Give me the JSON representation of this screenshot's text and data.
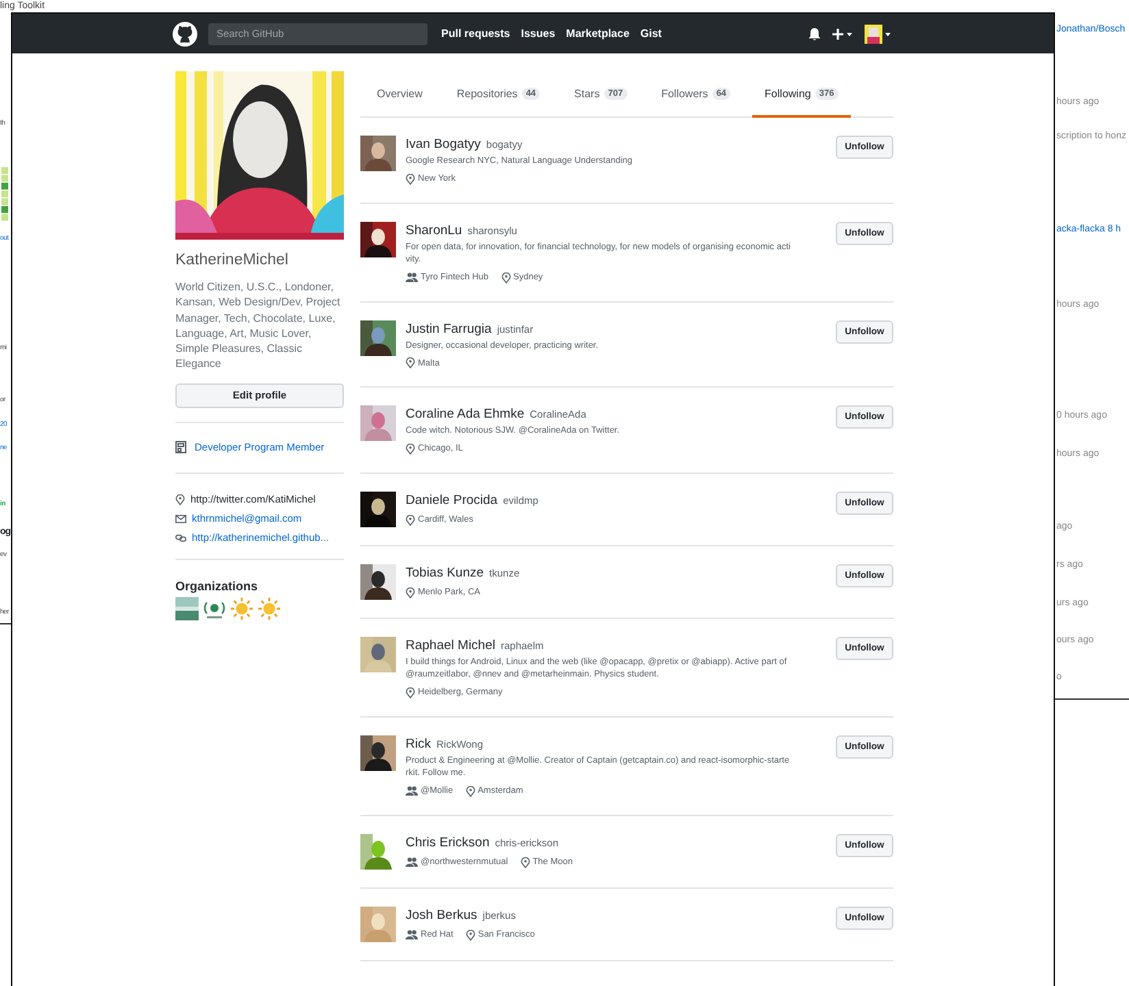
{
  "background": {
    "left_fragments": [
      "ling Toolkit",
      "th",
      "out",
      "mi",
      "or",
      "20",
      "ne",
      "in",
      "og",
      "ev",
      "her"
    ],
    "right_fragments": [
      "Jonathan/Bosch",
      "hours ago",
      "scription to honz",
      "acka-flacka 8 h",
      "hours ago",
      "0 hours ago",
      "hours ago",
      "ago",
      "rs ago",
      "urs ago",
      "ours ago",
      "o"
    ]
  },
  "header": {
    "search": {
      "placeholder": "Search GitHub"
    },
    "nav": [
      "Pull requests",
      "Issues",
      "Marketplace",
      "Gist"
    ]
  },
  "profile": {
    "username": "KatherineMichel",
    "bio": "World Citizen, U.S.C., Londoner, Kansan, Web Design/Dev, Project Manager, Tech, Chocolate, Luxe, Language, Art, Music Lover, Simple Pleasures, Classic Elegance",
    "edit_button": "Edit profile",
    "badge": "Developer Program Member",
    "links": [
      {
        "kind": "location",
        "text": "http://twitter.com/KatiMichel"
      },
      {
        "kind": "email",
        "text": "kthrnmichel@gmail.com"
      },
      {
        "kind": "website",
        "text": "http://katherinemichel.github..."
      }
    ],
    "organizations_title": "Organizations"
  },
  "tabs": [
    {
      "label": "Overview",
      "selected": false
    },
    {
      "label": "Repositories",
      "count": "44",
      "selected": false
    },
    {
      "label": "Stars",
      "count": "707",
      "selected": false
    },
    {
      "label": "Followers",
      "count": "64",
      "selected": false
    },
    {
      "label": "Following",
      "count": "376",
      "selected": true
    }
  ],
  "users": [
    {
      "name": "Ivan Bogatyy",
      "login": "bogatyy",
      "bio": "Google Research NYC, Natural Language Understanding",
      "location": "New York",
      "button": "Unfollow"
    },
    {
      "name": "SharonLu",
      "login": "sharonsylu",
      "bio": "For open data, for innovation, for financial technology, for new models of organising economic activity.",
      "company": "Tyro Fintech Hub",
      "location": "Sydney",
      "button": "Unfollow"
    },
    {
      "name": "Justin Farrugia",
      "login": "justinfar",
      "bio": "Designer, occasional developer, practicing writer.",
      "location": "Malta",
      "button": "Unfollow"
    },
    {
      "name": "Coraline Ada Ehmke",
      "login": "CoralineAda",
      "bio": "Code witch. Notorious SJW. @CoralineAda on Twitter.",
      "location": "Chicago, IL",
      "button": "Unfollow"
    },
    {
      "name": "Daniele Procida",
      "login": "evildmp",
      "location": "Cardiff, Wales",
      "button": "Unfollow"
    },
    {
      "name": "Tobias Kunze",
      "login": "tkunze",
      "location": "Menlo Park, CA",
      "button": "Unfollow"
    },
    {
      "name": "Raphael Michel",
      "login": "raphaelm",
      "bio": "I build things for Android, Linux and the web (like @opacapp, @pretix or @abiapp). Active part of @raumzeitlabor, @nnev and @metarheinmain. Physics student.",
      "location": "Heidelberg, Germany",
      "button": "Unfollow"
    },
    {
      "name": "Rick",
      "login": "RickWong",
      "bio": "Product & Engineering at @Mollie. Creator of Captain (getcaptain.co) and react-isomorphic-starterkit. Follow me.",
      "company": "@Mollie",
      "location": "Amsterdam",
      "button": "Unfollow"
    },
    {
      "name": "Chris Erickson",
      "login": "chris-erickson",
      "company": "@northwesternmutual",
      "location": "The Moon",
      "button": "Unfollow"
    },
    {
      "name": "Josh Berkus",
      "login": "jberkus",
      "company": "Red Hat",
      "location": "San Francisco",
      "button": "Unfollow"
    }
  ]
}
